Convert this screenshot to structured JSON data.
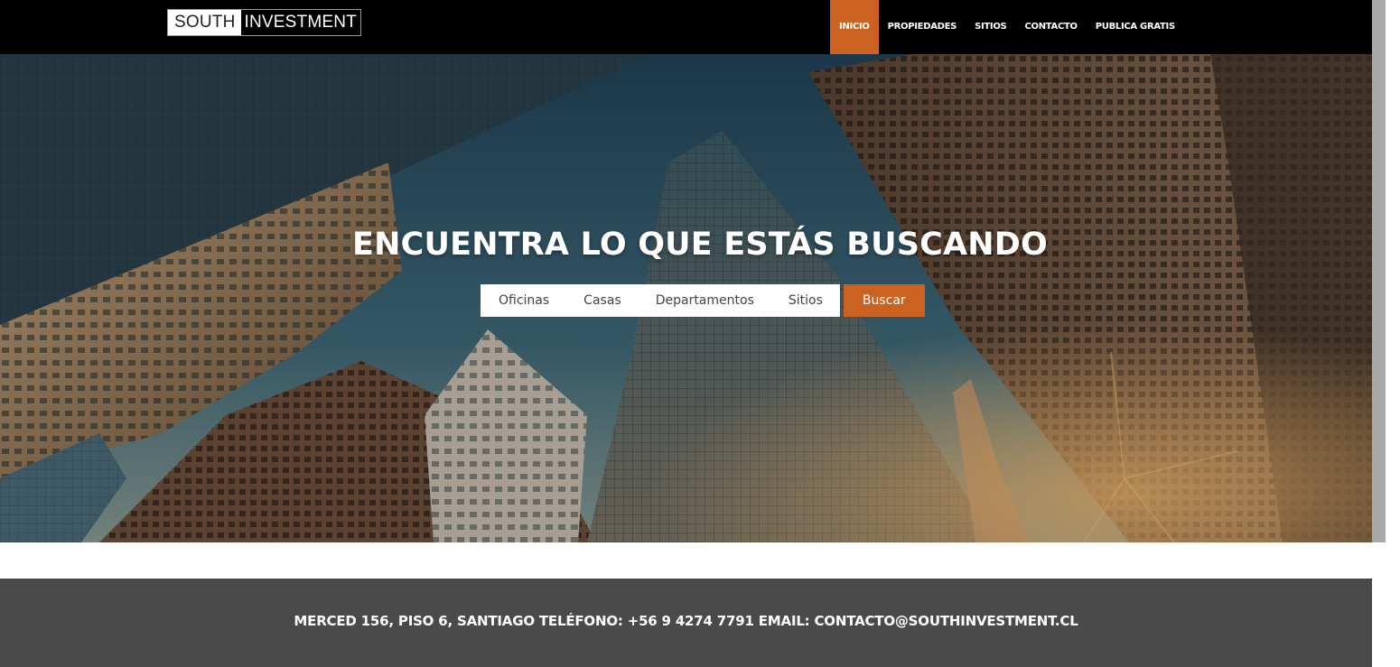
{
  "logo": {
    "part_light": "SOUTH",
    "part_dark": "INVESTMENT"
  },
  "nav": {
    "items": [
      {
        "label": "INICIO",
        "active": true
      },
      {
        "label": "PROPIEDADES",
        "active": false
      },
      {
        "label": "SITIOS",
        "active": false
      },
      {
        "label": "CONTACTO",
        "active": false
      },
      {
        "label": "PUBLICA GRATIS",
        "active": false
      }
    ]
  },
  "hero": {
    "title": "ENCUENTRA LO QUE ESTÁS BUSCANDO",
    "background_image": "city-skyscrapers-looking-up"
  },
  "search": {
    "tabs": [
      "Oficinas",
      "Casas",
      "Departamentos",
      "Sitios"
    ],
    "button_label": "Buscar"
  },
  "footer": {
    "text": "MERCED 156, PISO 6, SANTIAGO TELÉFONO: +56 9 4274 7791 EMAIL: CONTACTO@SOUTHINVESTMENT.CL"
  },
  "colors": {
    "accent": "#cc6222",
    "navbar": "#000000",
    "footer": "#4a4a4a",
    "scrollbar": "#a9a9a9"
  }
}
